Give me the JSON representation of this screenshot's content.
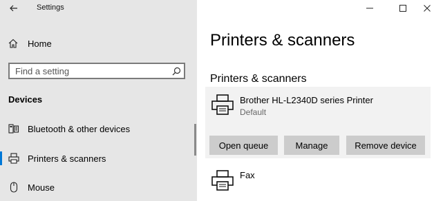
{
  "app": {
    "title": "Settings",
    "back_icon": "back-arrow-icon"
  },
  "window_controls": {
    "minimize_icon": "minimize-icon",
    "maximize_icon": "maximize-icon",
    "close_icon": "close-icon"
  },
  "sidebar": {
    "home_label": "Home",
    "search": {
      "placeholder": "Find a setting",
      "value": ""
    },
    "section_title": "Devices",
    "items": [
      {
        "label": "Bluetooth & other devices",
        "icon": "bluetooth-devices-icon",
        "selected": false
      },
      {
        "label": "Printers & scanners",
        "icon": "printer-icon",
        "selected": true
      },
      {
        "label": "Mouse",
        "icon": "mouse-icon",
        "selected": false
      }
    ]
  },
  "main": {
    "title": "Printers & scanners",
    "subtitle": "Printers & scanners",
    "printers": [
      {
        "name": "Brother HL-L2340D series Printer",
        "status": "Default",
        "buttons": {
          "open_queue": "Open queue",
          "manage": "Manage",
          "remove": "Remove device"
        }
      },
      {
        "name": "Fax"
      }
    ]
  },
  "colors": {
    "sidebar_bg": "#e6e6e6",
    "accent": "#0078d7",
    "card_bg": "#f2f2f2",
    "button_bg": "#cccccc"
  }
}
